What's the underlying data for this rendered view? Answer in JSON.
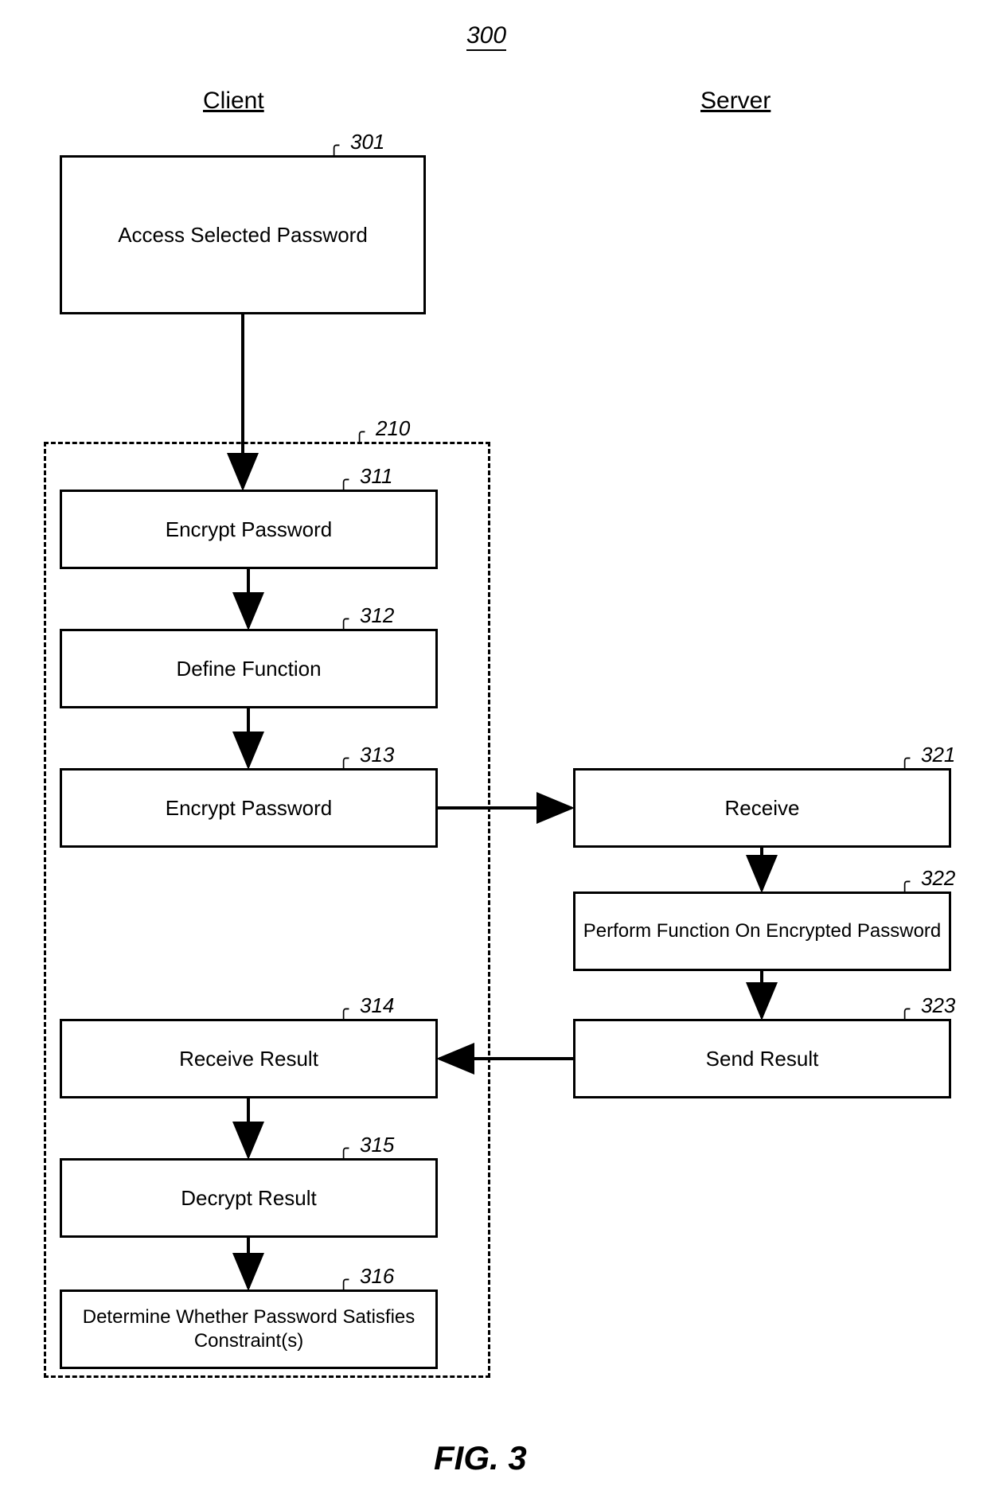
{
  "figure": {
    "reference": "300",
    "caption": "FIG. 3"
  },
  "headers": {
    "client": "Client",
    "server": "Server"
  },
  "callouts": {
    "c301": "301",
    "c210": "210",
    "c311": "311",
    "c312": "312",
    "c313": "313",
    "c314": "314",
    "c315": "315",
    "c316": "316",
    "c321": "321",
    "c322": "322",
    "c323": "323"
  },
  "boxes": {
    "b301": "Access Selected Password",
    "b311": "Encrypt Password",
    "b312": "Define Function",
    "b313": "Encrypt Password",
    "b314": "Receive Result",
    "b315": "Decrypt Result",
    "b316": "Determine Whether Password Satisfies Constraint(s)",
    "b321": "Receive",
    "b322": "Perform Function On Encrypted Password",
    "b323": "Send Result"
  },
  "chart_data": {
    "type": "flowchart",
    "title": "FIG. 3 (300)",
    "lanes": [
      "Client",
      "Server"
    ],
    "nodes": [
      {
        "id": "301",
        "lane": "Client",
        "label": "Access Selected Password"
      },
      {
        "id": "210",
        "lane": "Client",
        "label": "Dashed group container",
        "container": true,
        "children": [
          "311",
          "312",
          "313",
          "314",
          "315",
          "316"
        ]
      },
      {
        "id": "311",
        "lane": "Client",
        "label": "Encrypt Password"
      },
      {
        "id": "312",
        "lane": "Client",
        "label": "Define Function"
      },
      {
        "id": "313",
        "lane": "Client",
        "label": "Encrypt Password"
      },
      {
        "id": "314",
        "lane": "Client",
        "label": "Receive Result"
      },
      {
        "id": "315",
        "lane": "Client",
        "label": "Decrypt Result"
      },
      {
        "id": "316",
        "lane": "Client",
        "label": "Determine Whether Password Satisfies Constraint(s)"
      },
      {
        "id": "321",
        "lane": "Server",
        "label": "Receive"
      },
      {
        "id": "322",
        "lane": "Server",
        "label": "Perform Function On Encrypted Password"
      },
      {
        "id": "323",
        "lane": "Server",
        "label": "Send Result"
      }
    ],
    "edges": [
      {
        "from": "301",
        "to": "311"
      },
      {
        "from": "311",
        "to": "312"
      },
      {
        "from": "312",
        "to": "313"
      },
      {
        "from": "313",
        "to": "321"
      },
      {
        "from": "321",
        "to": "322"
      },
      {
        "from": "322",
        "to": "323"
      },
      {
        "from": "323",
        "to": "314"
      },
      {
        "from": "314",
        "to": "315"
      },
      {
        "from": "315",
        "to": "316"
      }
    ]
  }
}
